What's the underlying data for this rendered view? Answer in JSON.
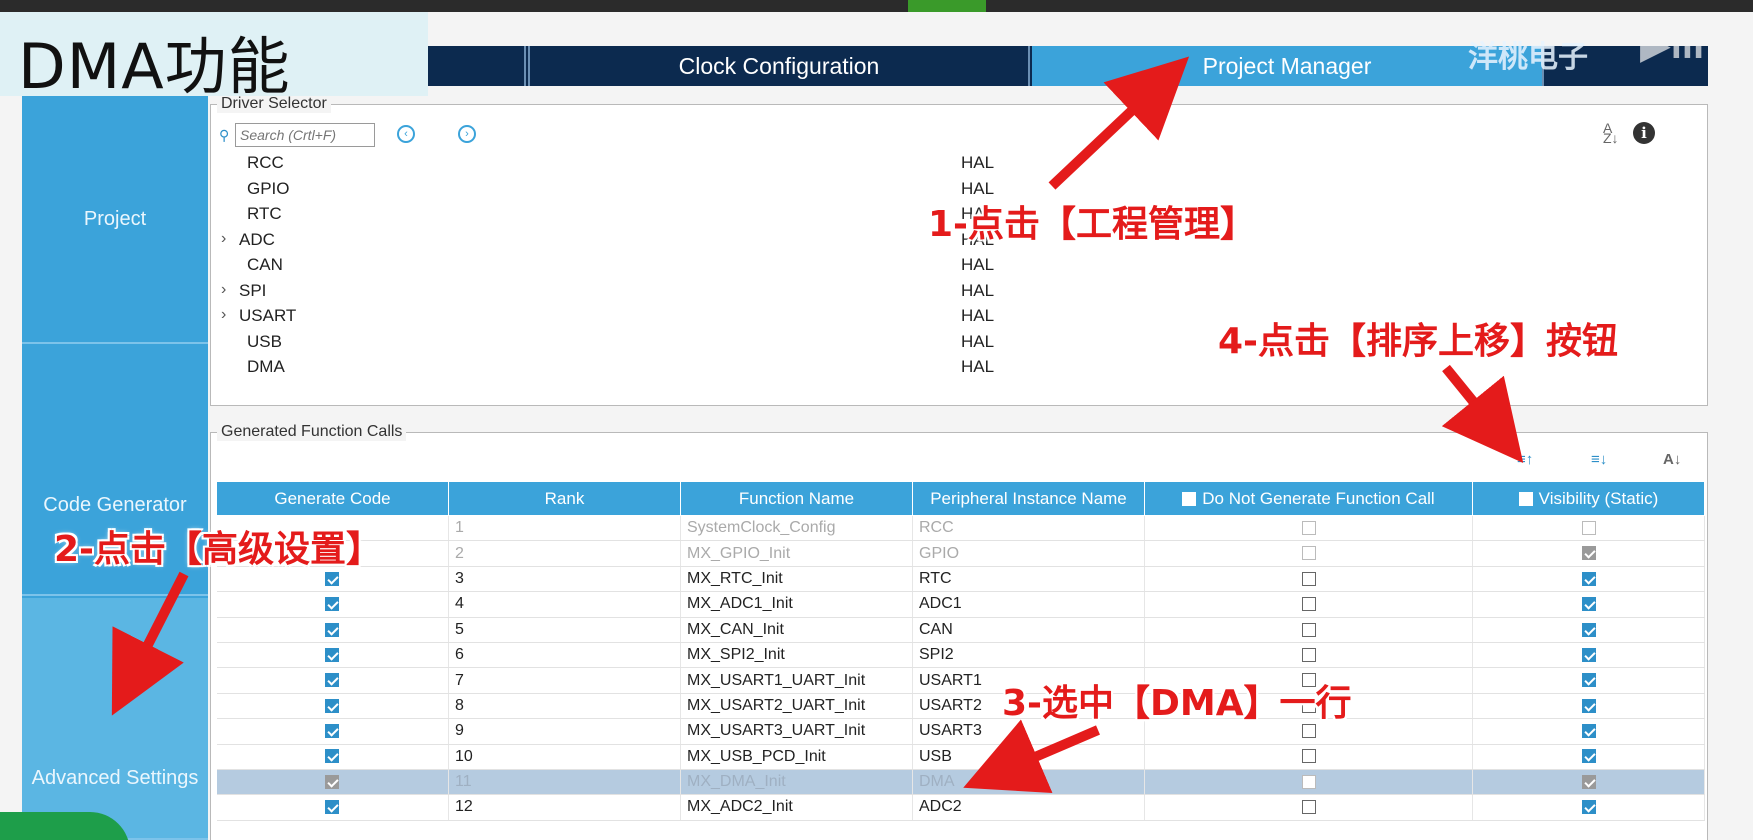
{
  "title": "DMA功能",
  "tabs": {
    "clock": "Clock Configuration",
    "project_manager": "Project Manager"
  },
  "watermark": "洋桃电子",
  "sidebar": {
    "project": "Project",
    "code_generator": "Code Generator",
    "advanced_settings": "Advanced Settings"
  },
  "driver_selector": {
    "legend": "Driver Selector",
    "search_placeholder": "Search (Crtl+F)",
    "rows": [
      {
        "name": "RCC",
        "value": "HAL",
        "expandable": false
      },
      {
        "name": "GPIO",
        "value": "HAL",
        "expandable": false
      },
      {
        "name": "RTC",
        "value": "HAL",
        "expandable": false
      },
      {
        "name": "ADC",
        "value": "HAL",
        "expandable": true
      },
      {
        "name": "CAN",
        "value": "HAL",
        "expandable": false
      },
      {
        "name": "SPI",
        "value": "HAL",
        "expandable": true
      },
      {
        "name": "USART",
        "value": "HAL",
        "expandable": true
      },
      {
        "name": "USB",
        "value": "HAL",
        "expandable": false
      },
      {
        "name": "DMA",
        "value": "HAL",
        "expandable": false
      }
    ]
  },
  "generated_calls": {
    "legend": "Generated Function Calls",
    "columns": [
      "Generate Code",
      "Rank",
      "Function Name",
      "Peripheral Instance Name",
      "Do Not Generate Function Call",
      "Visibility (Static)"
    ],
    "rows": [
      {
        "generate": false,
        "rank": "1",
        "function": "SystemClock_Config",
        "peripheral": "RCC",
        "no_call": false,
        "visibility": false,
        "state": "disabled"
      },
      {
        "generate": false,
        "rank": "2",
        "function": "MX_GPIO_Init",
        "peripheral": "GPIO",
        "no_call": false,
        "visibility": true,
        "state": "disabled"
      },
      {
        "generate": true,
        "rank": "3",
        "function": "MX_RTC_Init",
        "peripheral": "RTC",
        "no_call": false,
        "visibility": true,
        "state": "normal"
      },
      {
        "generate": true,
        "rank": "4",
        "function": "MX_ADC1_Init",
        "peripheral": "ADC1",
        "no_call": false,
        "visibility": true,
        "state": "normal"
      },
      {
        "generate": true,
        "rank": "5",
        "function": "MX_CAN_Init",
        "peripheral": "CAN",
        "no_call": false,
        "visibility": true,
        "state": "normal"
      },
      {
        "generate": true,
        "rank": "6",
        "function": "MX_SPI2_Init",
        "peripheral": "SPI2",
        "no_call": false,
        "visibility": true,
        "state": "normal"
      },
      {
        "generate": true,
        "rank": "7",
        "function": "MX_USART1_UART_Init",
        "peripheral": "USART1",
        "no_call": false,
        "visibility": true,
        "state": "normal"
      },
      {
        "generate": true,
        "rank": "8",
        "function": "MX_USART2_UART_Init",
        "peripheral": "USART2",
        "no_call": false,
        "visibility": true,
        "state": "normal"
      },
      {
        "generate": true,
        "rank": "9",
        "function": "MX_USART3_UART_Init",
        "peripheral": "USART3",
        "no_call": false,
        "visibility": true,
        "state": "normal"
      },
      {
        "generate": true,
        "rank": "10",
        "function": "MX_USB_PCD_Init",
        "peripheral": "USB",
        "no_call": false,
        "visibility": true,
        "state": "normal"
      },
      {
        "generate": true,
        "rank": "11",
        "function": "MX_DMA_Init",
        "peripheral": "DMA",
        "no_call": false,
        "visibility": true,
        "state": "selected"
      },
      {
        "generate": true,
        "rank": "12",
        "function": "MX_ADC2_Init",
        "peripheral": "ADC2",
        "no_call": false,
        "visibility": true,
        "state": "normal"
      }
    ]
  },
  "annotations": {
    "step1": "1-点击【工程管理】",
    "step2": "2-点击【高级设置】",
    "step3": "3-选中【DMA】一行",
    "step4": "4-点击【排序上移】按钮"
  },
  "colors": {
    "accent": "#3ba3da",
    "tab_dark": "#0c2a4f",
    "annotation": "#e41b1b",
    "selected_row": "#b5cbe0"
  }
}
